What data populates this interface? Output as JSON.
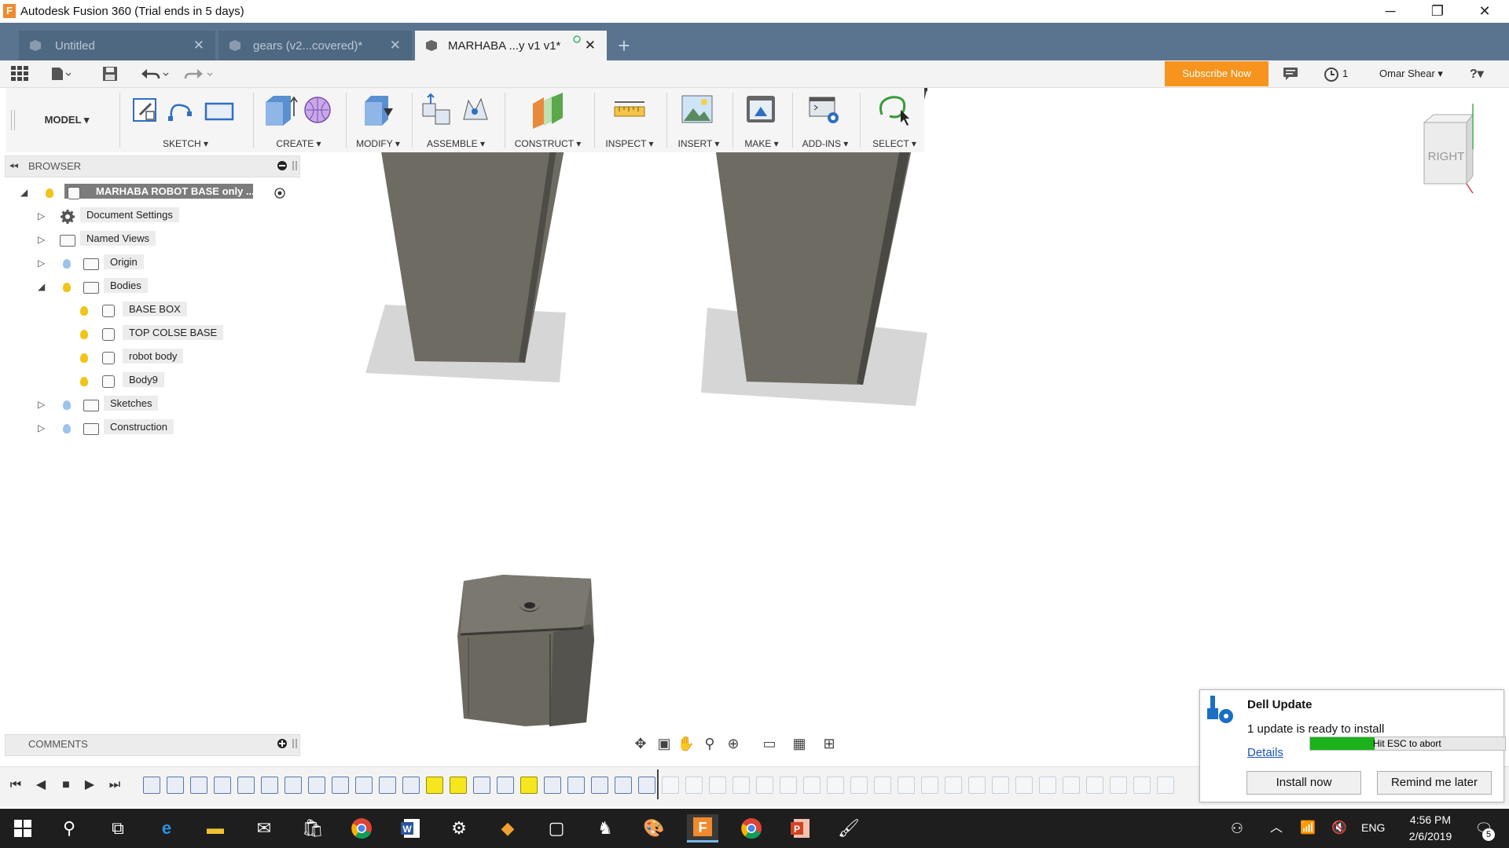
{
  "window": {
    "title": "Autodesk Fusion 360 (Trial ends in 5 days)",
    "app_icon_letter": "F",
    "min": "─",
    "restore": "❐",
    "close": "✕"
  },
  "tabs": [
    {
      "label": "Untitled",
      "close": "✕"
    },
    {
      "label": "gears (v2...covered)*",
      "close": "✕"
    },
    {
      "label": "MARHABA ...y v1 v1*",
      "close": "✕"
    }
  ],
  "tab_add": "+",
  "appbar": {
    "subscribe_label": "Subscribe Now",
    "job_count": "1",
    "user": "Omar Shear ▾",
    "help": "?▾"
  },
  "toolbar": {
    "workspace": "MODEL ▾",
    "groups": [
      "SKETCH ▾",
      "CREATE ▾",
      "MODIFY ▾",
      "ASSEMBLE ▾",
      "CONSTRUCT ▾",
      "INSPECT ▾",
      "INSERT ▾",
      "MAKE ▾",
      "ADD-INS ▾",
      "SELECT ▾"
    ]
  },
  "browser": {
    "title": "BROWSER",
    "root": "MARHABA ROBOT BASE only ...",
    "nodes": [
      "Document Settings",
      "Named Views",
      "Origin",
      "Bodies",
      "Sketches",
      "Construction"
    ],
    "bodies": [
      "BASE BOX",
      "TOP COLSE BASE",
      "robot body",
      "Body9"
    ]
  },
  "comments": {
    "title": "COMMENTS"
  },
  "viewcube": {
    "face": "RIGHT"
  },
  "notification": {
    "title": "Dell Update",
    "message": "1 update is ready to install",
    "details": "Details",
    "progress_text": "Hit ESC to abort",
    "progress": 0.33,
    "install": "Install now",
    "remind": "Remind me later"
  },
  "tray": {
    "lang": "ENG",
    "time": "4:56 PM",
    "date": "2/6/2019",
    "notifications": "5"
  },
  "colors": {
    "tab_bar": "#5a7490",
    "subscribe": "#f7941d",
    "taskbar": "#1e1e1e",
    "body_gray": "#6e6b62"
  }
}
